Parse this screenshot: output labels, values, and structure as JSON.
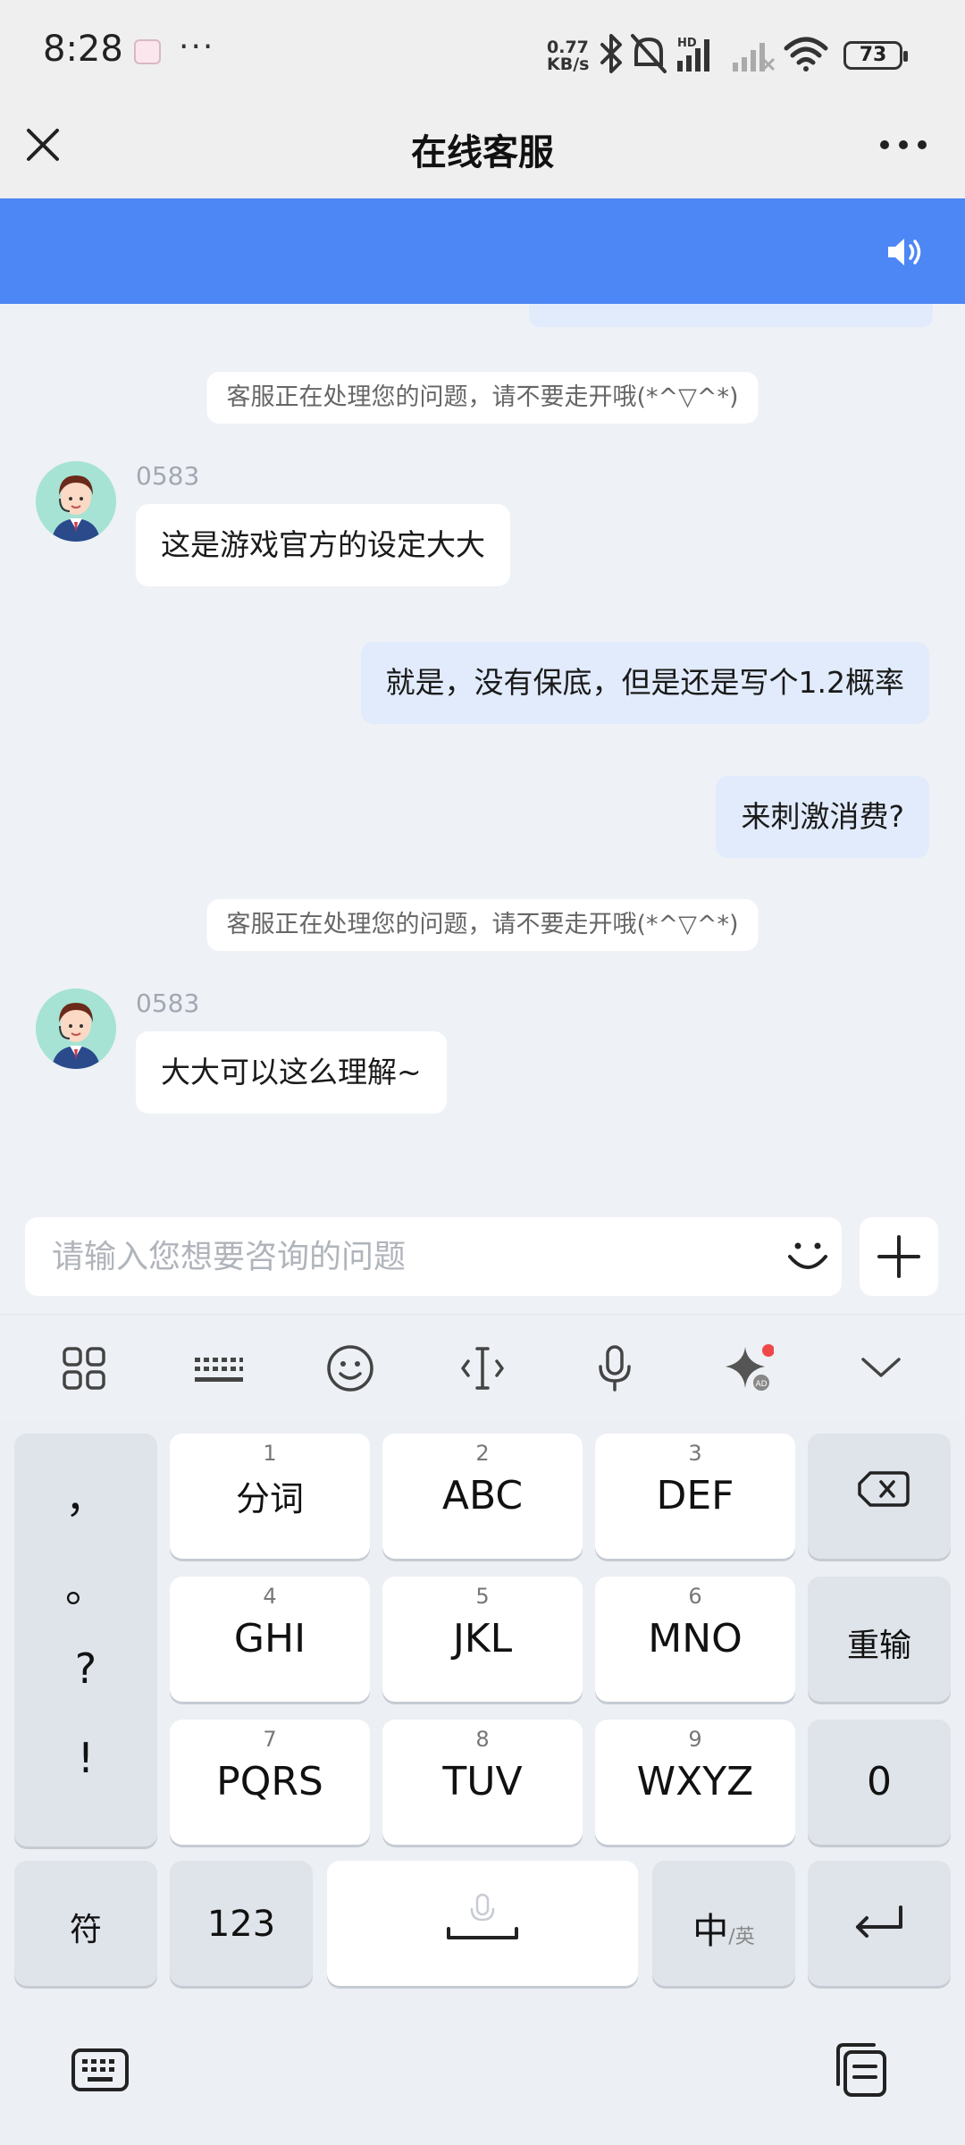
{
  "status_bar": {
    "time": "8:28",
    "net_speed_value": "0.77",
    "net_speed_unit": "KB/s",
    "battery": "73"
  },
  "header": {
    "title": "在线客服"
  },
  "chat": {
    "system_message": "客服正在处理您的问题，请不要走开哦(*^▽^*)",
    "messages": [
      {
        "side": "in",
        "sender": "0583",
        "text": "这是游戏官方的设定大大"
      },
      {
        "side": "out",
        "text": "就是，没有保底，但是还是写个1.2概率"
      },
      {
        "side": "out",
        "text": "来刺激消费?"
      },
      {
        "side": "in",
        "sender": "0583",
        "text": "大大可以这么理解~"
      }
    ]
  },
  "composer": {
    "placeholder": "请输入您想要咨询的问题"
  },
  "keyboard": {
    "symbols": [
      "，",
      "。",
      "?",
      "!"
    ],
    "keys": [
      {
        "num": "1",
        "label": "分词"
      },
      {
        "num": "2",
        "label": "ABC"
      },
      {
        "num": "3",
        "label": "DEF"
      },
      {
        "num": "4",
        "label": "GHI"
      },
      {
        "num": "5",
        "label": "JKL"
      },
      {
        "num": "6",
        "label": "MNO"
      },
      {
        "num": "7",
        "label": "PQRS"
      },
      {
        "num": "8",
        "label": "TUV"
      },
      {
        "num": "9",
        "label": "WXYZ"
      }
    ],
    "reenter": "重输",
    "zero": "0",
    "fu": "符",
    "num_switch": "123",
    "lang_main": "中",
    "lang_sub": "/英"
  },
  "colors": {
    "banner": "#4d86f5",
    "outgoing_bubble": "#e1ebfb",
    "incoming_bubble": "#ffffff",
    "notification_dot": "#f04848"
  }
}
